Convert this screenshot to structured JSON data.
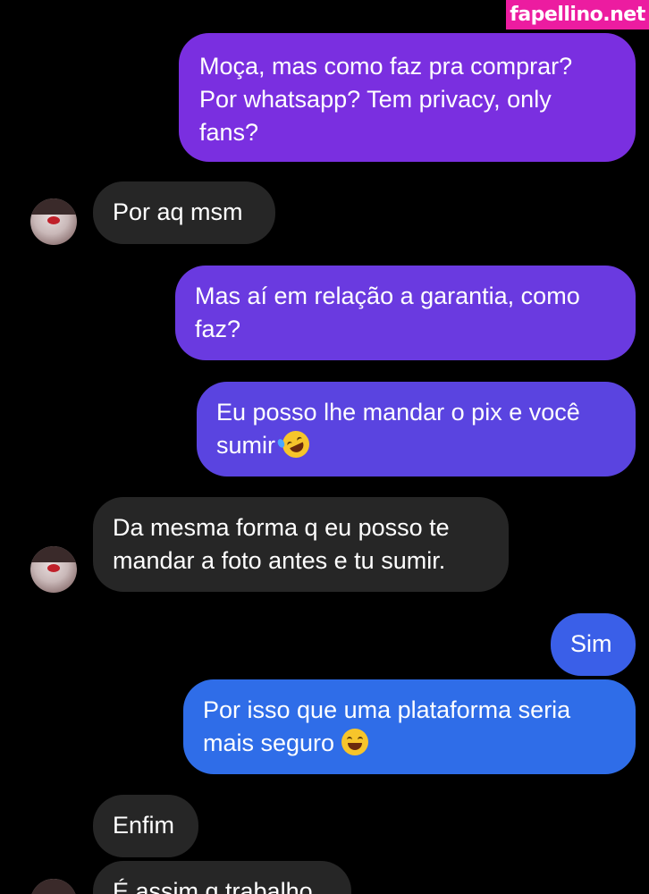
{
  "watermark": {
    "text": "fapellino.net"
  },
  "messages": [
    {
      "sender": "me",
      "text": "Moça, mas como faz pra comprar? Por whatsapp? Tem privacy, only fans?",
      "color": "#7a2fe0"
    },
    {
      "sender": "them",
      "text": "Por aq msm"
    },
    {
      "sender": "me",
      "text": "Mas aí em relação a garantia, como faz?",
      "color": "#6a3ae0"
    },
    {
      "sender": "me",
      "text": "Eu posso lhe mandar o pix e você sumir",
      "emoji": "rolling-on-floor-laughing",
      "color": "#5a44e0"
    },
    {
      "sender": "them",
      "text": "Da mesma forma q eu posso te mandar a foto antes e tu sumir."
    },
    {
      "sender": "me",
      "text": "Sim",
      "color": "#3a5fe8"
    },
    {
      "sender": "me",
      "text": "Por isso que uma plataforma seria mais seguro",
      "emoji": "grinning-sweat",
      "color": "#2f6de8"
    },
    {
      "sender": "them",
      "text": "Enfim"
    },
    {
      "sender": "them",
      "text": "É assim q trabalho"
    }
  ]
}
